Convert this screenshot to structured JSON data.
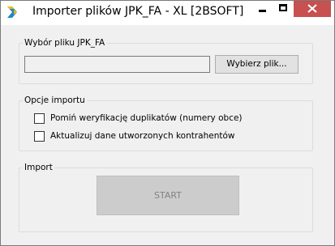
{
  "window": {
    "title": "Importer plików JPK_FA - XL [2BSOFT]",
    "icons": {
      "app": "app-logo-icon",
      "minimize": "minimize-icon",
      "maximize": "maximize-icon",
      "close": "close-icon"
    },
    "colors": {
      "close_button": "#c75050",
      "app_icon_blue": "#1e88c8",
      "app_icon_yellow": "#f5b800"
    }
  },
  "file_group": {
    "label": "Wybór pliku JPK_FA",
    "path_value": "",
    "browse_label": "Wybierz plik..."
  },
  "options_group": {
    "label": "Opcje importu",
    "options": [
      {
        "label": "Pomiń weryfikację duplikatów (numery obce)",
        "checked": false
      },
      {
        "label": "Aktualizuj dane utworzonych kontrahentów",
        "checked": false
      }
    ]
  },
  "import_group": {
    "label": "Import",
    "start_label": "START",
    "start_enabled": false
  }
}
